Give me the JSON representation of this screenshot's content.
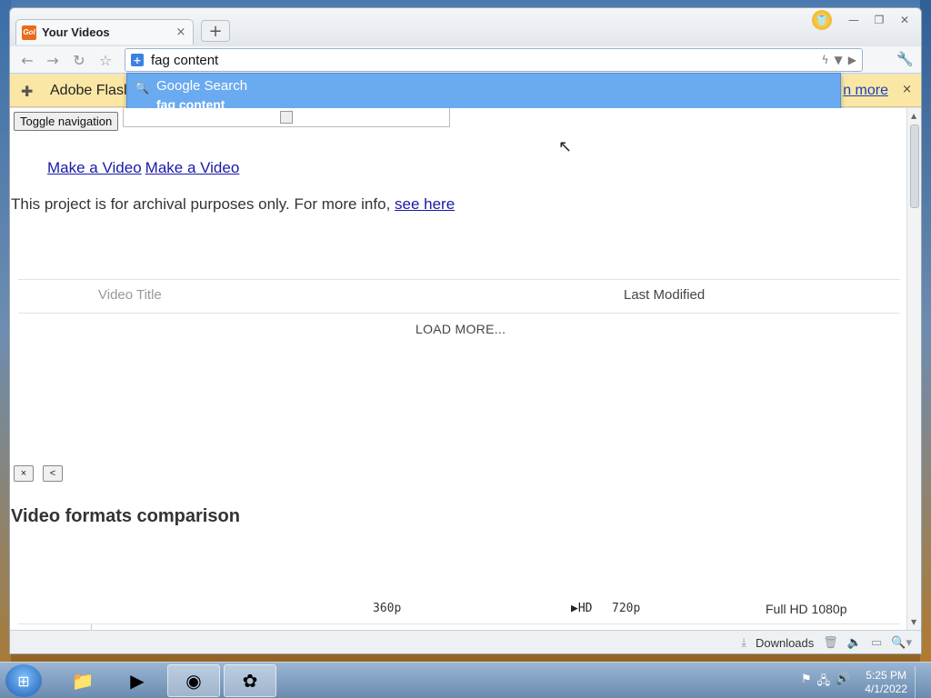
{
  "browser": {
    "tab": {
      "favicon": "Gol",
      "title": "Your Videos",
      "close": "×"
    },
    "new_tab": "+",
    "window_controls": {
      "minimize": "—",
      "restore": "❐",
      "close": "✕"
    },
    "nav": {
      "back": "←",
      "forward": "→",
      "reload": "↻",
      "star": "☆"
    },
    "omnibox": {
      "value": "fag content",
      "icon": "shield-plus-icon"
    },
    "wrench": "🔧"
  },
  "infobar": {
    "text": "Adobe Flasl",
    "link": "n more",
    "close": "×"
  },
  "suggestion": {
    "title": "Google Search",
    "query": "fag content"
  },
  "page": {
    "toggle_nav": "Toggle navigation",
    "make_video_1": "Make a Video",
    "make_video_2": "Make a Video",
    "archival_text": "This project is for archival purposes only. For more info, ",
    "archival_link": "see here",
    "table_header_title": "Video Title",
    "table_header_modified": "Last Modified",
    "load_more": "LOAD MORE...",
    "btn_close": "×",
    "btn_back": "<",
    "formats_heading": "Video formats comparison",
    "res_360": "360p",
    "res_hd": "▶HD",
    "res_720": "720p",
    "res_1080": "Full HD 1080p"
  },
  "statusbar": {
    "downloads": "Downloads"
  },
  "taskbar": {
    "time": "5:25 PM",
    "date": "4/1/2022"
  }
}
